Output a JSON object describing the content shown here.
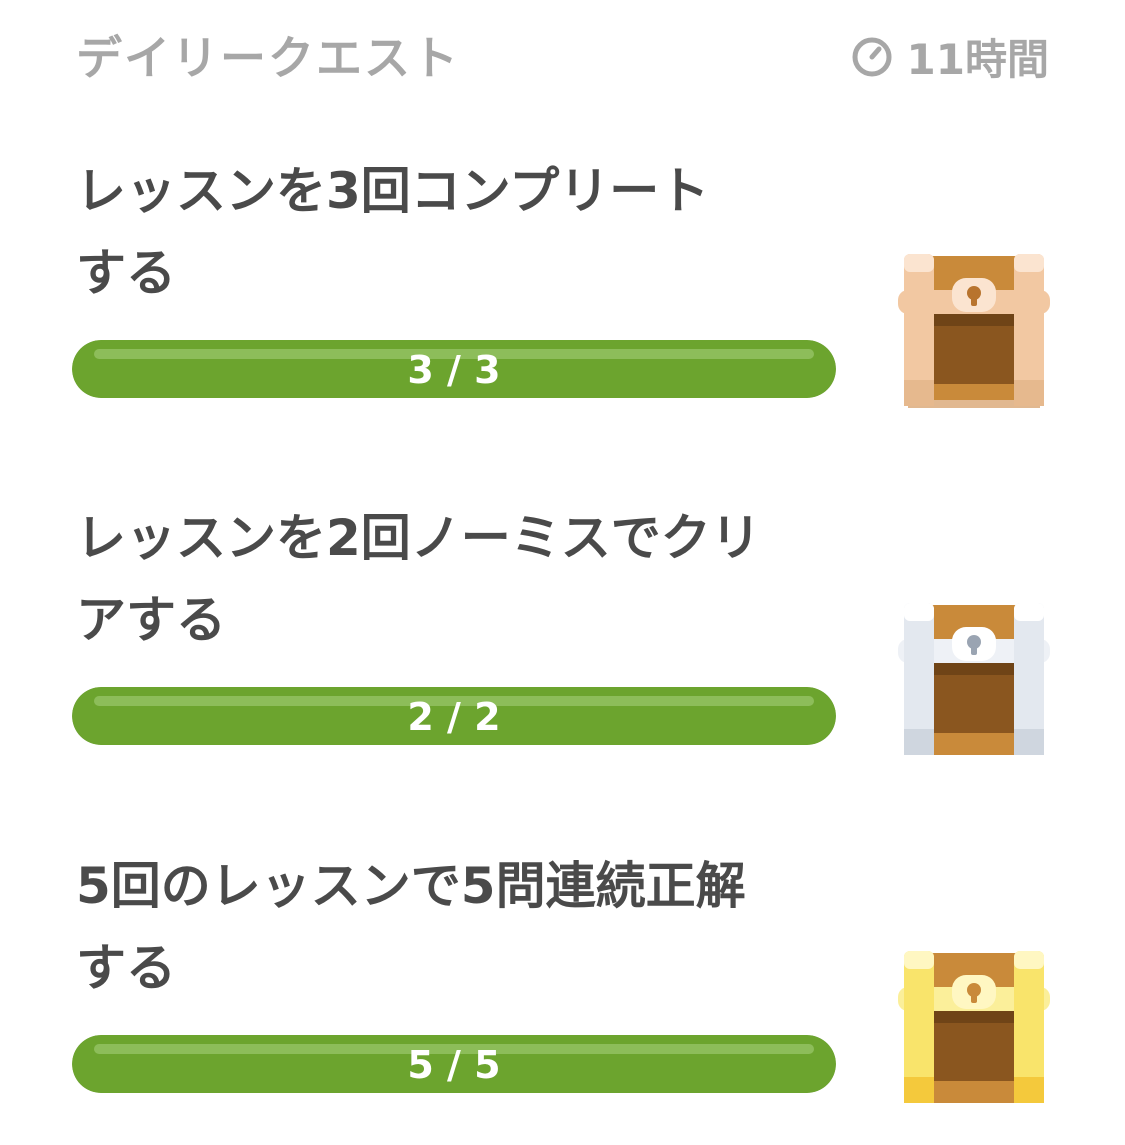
{
  "header": {
    "title": "デイリークエスト",
    "timer_label": "11時間",
    "timer_icon": "clock-icon"
  },
  "quests": [
    {
      "title_line1": "レッスンを3回コンプリート",
      "title_line2": "する",
      "progress_label": "3 / 3",
      "progress": 1.0,
      "chest": "bronze-chest-icon"
    },
    {
      "title_line1": "レッスンを2回ノーミスでクリ",
      "title_line2": "アする",
      "progress_label": "2 / 2",
      "progress": 1.0,
      "chest": "silver-chest-icon"
    },
    {
      "title_line1": "5回のレッスンで5問連続正解",
      "title_line2": "する",
      "progress_label": "5 / 5",
      "progress": 1.0,
      "chest": "gold-chest-icon"
    }
  ],
  "colors": {
    "progress_fill": "#6ca42e",
    "progress_shine": "#8dbd5a",
    "header_text": "#a7a7a7",
    "title_text": "#4a4a4a",
    "chest_wood": "#c98a3a",
    "chest_bronze": "#f2c8a2",
    "chest_silver": "#e3e8ef",
    "chest_gold": "#f9e46b"
  }
}
